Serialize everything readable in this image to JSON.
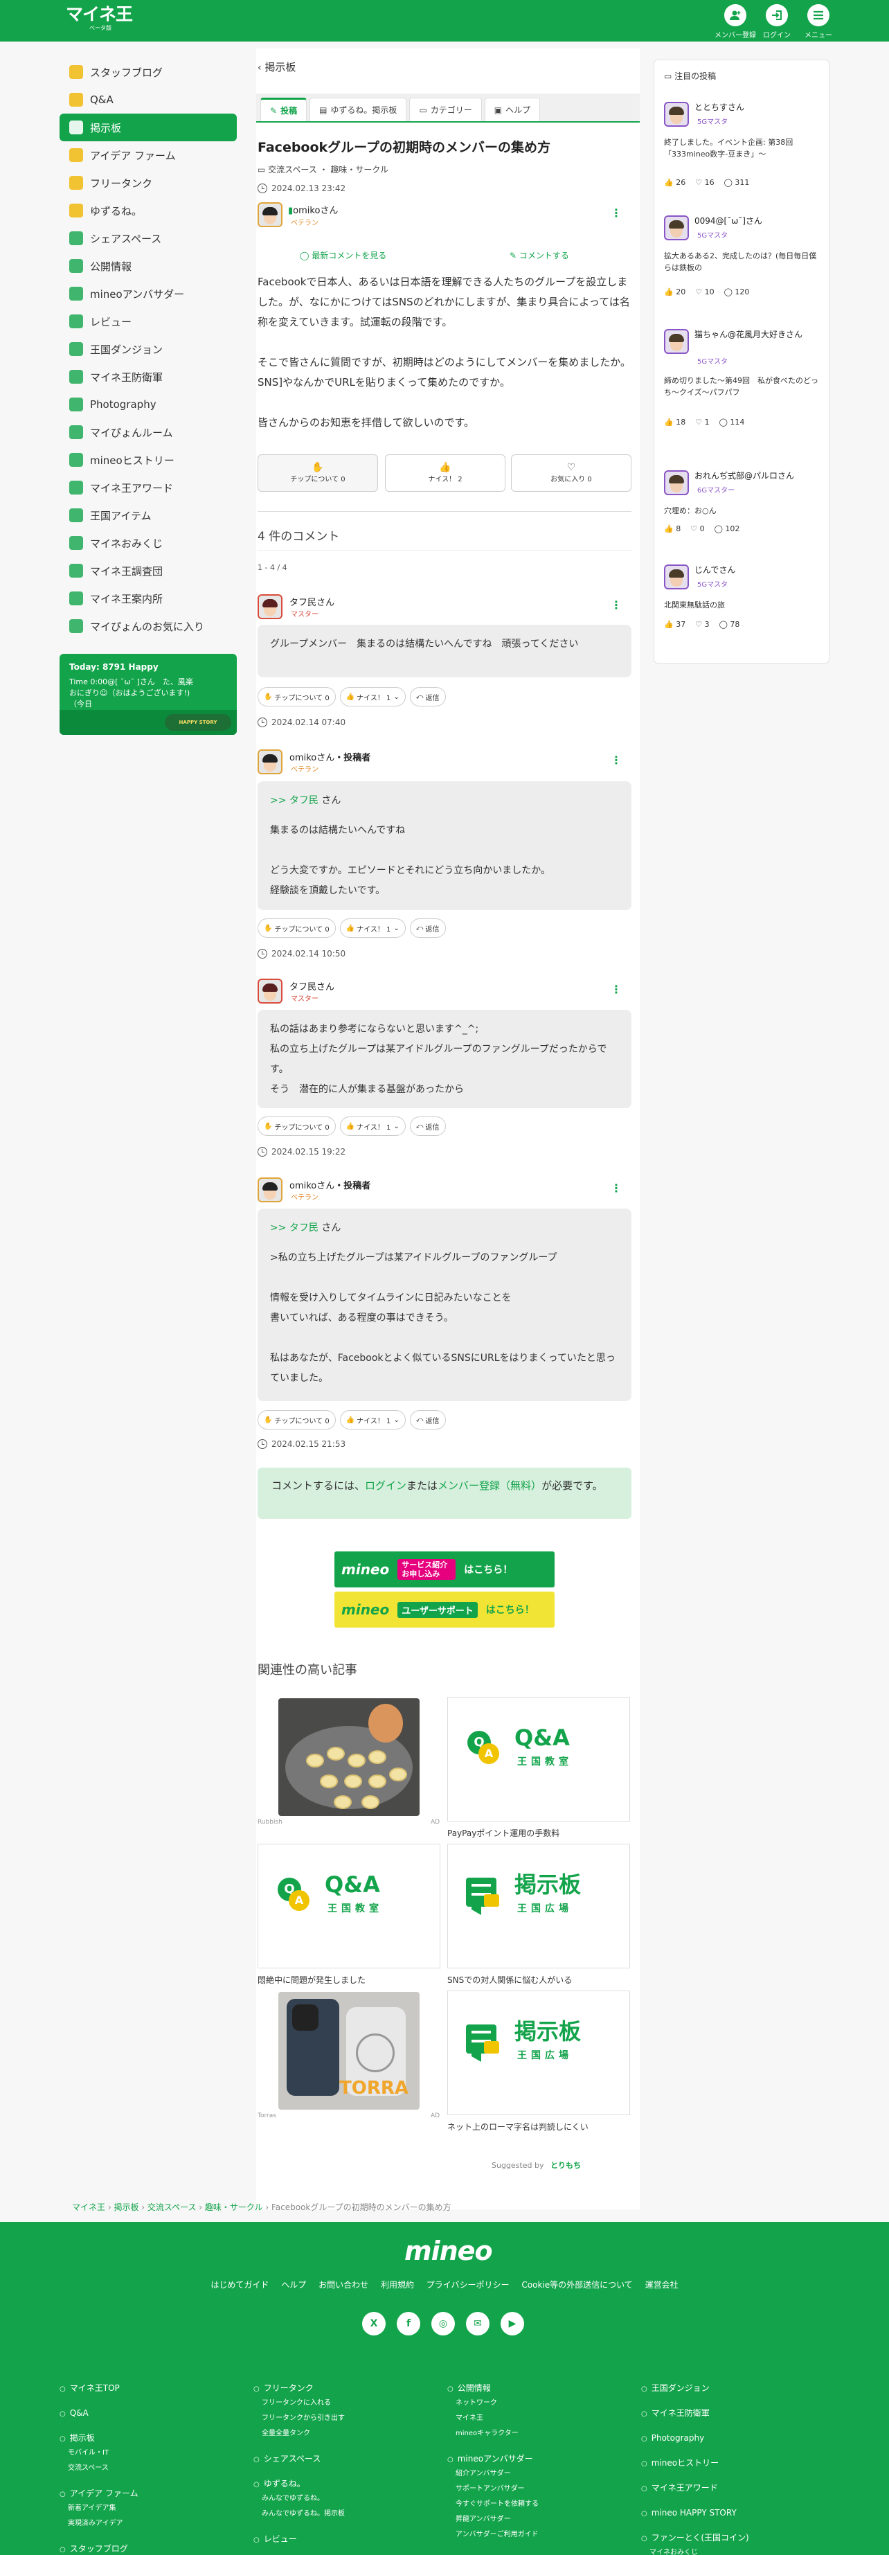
{
  "header": {
    "logo_main": "マイネ王",
    "logo_sub": "ベータ版",
    "register": "メンバー登録",
    "login": "ログイン",
    "menu": "メニュー"
  },
  "nav": [
    {
      "label": "スタッフブログ",
      "color": "#f0b400"
    },
    {
      "label": "Q&A",
      "color": "#f0b400"
    },
    {
      "label": "掲示板",
      "color": "#f0b400",
      "active": true
    },
    {
      "label": "アイデア ファーム",
      "color": "#f0b400"
    },
    {
      "label": "フリータンク",
      "color": "#f0b400"
    },
    {
      "label": "ゆずるね。",
      "color": "#f0b400"
    },
    {
      "label": "シェアスペース",
      "color": "#13a44b"
    },
    {
      "label": "公開情報",
      "color": "#13a44b"
    },
    {
      "label": "mineoアンバサダー",
      "color": "#13a44b"
    },
    {
      "label": "レビュー",
      "color": "#13a44b"
    },
    {
      "label": "王国ダンジョン",
      "color": "#13a44b"
    },
    {
      "label": "マイネ王防衛軍",
      "color": "#13a44b"
    },
    {
      "label": "Photography",
      "color": "#13a44b"
    },
    {
      "label": "マイぴょんルーム",
      "color": "#13a44b"
    },
    {
      "label": "mineoヒストリー",
      "color": "#13a44b"
    },
    {
      "label": "マイネ王アワード",
      "color": "#13a44b"
    },
    {
      "label": "王国アイテム",
      "color": "#13a44b"
    },
    {
      "label": "マイネおみくじ",
      "color": "#13a44b"
    },
    {
      "label": "マイネ王調査団",
      "color": "#13a44b"
    },
    {
      "label": "マイネ王案内所",
      "color": "#13a44b"
    },
    {
      "label": "マイぴょんのお気に入り",
      "color": "#13a44b"
    }
  ],
  "today": {
    "title": "Today: 8791 Happy",
    "line1": "Time 0:00@[ ˘ω˘ ]さん　た、風楽",
    "line2": "おにぎり☺（おはようございます!)",
    "line3": "（今日",
    "badge": "HAPPY STORY"
  },
  "main": {
    "back": "掲示板",
    "tabs": [
      "投稿",
      "ゆずるね。掲示板",
      "カテゴリー",
      "ヘルプ"
    ],
    "title": "Facebookグループの初期時のメンバーの集め方",
    "category": "交流スペース ・ 趣味・サークル",
    "post_date": "2024.02.13 23:42",
    "author": "omikoさん",
    "author_rank": "ベテラン",
    "latest_comments": "最新コメントを見る",
    "comment_action": "コメントする",
    "body": [
      "Facebookで日本人、あるいは日本語を理解できる人たちのグループを設立しました。が、なにかにつけてはSNSのどれかにしますが、集まり具合によっては名称を変えていきます。試運転の段階です。",
      "そこで皆さんに質問ですが、初期時はどのようにしてメンバーを集めましたか。SNS]やなんかでURLを貼りまくって集めたのですか。",
      "皆さんからのお知恵を拝借して欲しいのです。"
    ],
    "reactions": [
      {
        "label": "チップについて 0",
        "icon": "✋"
      },
      {
        "label": "ナイス！ 2",
        "icon": "👍"
      },
      {
        "label": "お気に入り 0",
        "icon": "♡"
      }
    ],
    "comments_heading": "4 件のコメント",
    "pager": "1 - 4 / 4",
    "comments": [
      {
        "author": "タフ民さん",
        "rank": "マスター",
        "op": "",
        "lines": [
          "グループメンバー　集まるのは結構たいへんですね　頑張ってください"
        ],
        "tip": "チップについて 0",
        "nice": "ナイス！ 1",
        "reply": "返信",
        "date": "2024.02.14 07:40"
      },
      {
        "author": "omikoさん",
        "rank": "ベテラン",
        "op": "・投稿者",
        "quote": ">> タフ民",
        "quote_suffix": " さん",
        "lines": [
          "集まるのは結構たいへんですね",
          "",
          "どう大変ですか。エピソードとそれにどう立ち向かいましたか。",
          "経験談を頂戴したいです。"
        ],
        "tip": "チップについて 0",
        "nice": "ナイス！ 1",
        "reply": "返信",
        "date": "2024.02.14 10:50"
      },
      {
        "author": "タフ民さん",
        "rank": "マスター",
        "op": "",
        "lines": [
          "私の話はあまり参考にならないと思います^_^;",
          "私の立ち上げたグループは某アイドルグループのファングループだったからです。",
          "そう　潜在的に人が集まる基盤があったから"
        ],
        "tip": "チップについて 0",
        "nice": "ナイス！ 1",
        "reply": "返信",
        "date": "2024.02.15 19:22"
      },
      {
        "author": "omikoさん",
        "rank": "ベテラン",
        "op": "・投稿者",
        "quote": ">> タフ民",
        "quote_suffix": " さん",
        "lines": [
          ">私の立ち上げたグループは某アイドルグループのファングループ",
          "",
          "情報を受け入りしてタイムラインに日記みたいなことを",
          "書いていれば、ある程度の事はできそう。",
          "",
          "私はあなたが、Facebookとよく似ているSNSにURLをはりまくっていたと思っていました。"
        ],
        "tip": "チップについて 0",
        "nice": "ナイス！ 1",
        "reply": "返信",
        "date": "2024.02.15 21:53"
      }
    ],
    "login_notice": {
      "pre": "コメントするには、",
      "login": "ログイン",
      "mid": "または",
      "register": "メンバー登録（無料）",
      "post": "が必要です。"
    },
    "banner1": {
      "brand": "mineo",
      "text": "サービス紹介 お申し込み",
      "cta": "はこちら！"
    },
    "banner2": {
      "brand": "mineo",
      "text": "ユーザーサポート",
      "cta": "はこちら！"
    },
    "related_heading": "関連性の高い記事",
    "related": [
      {
        "caption": "",
        "small_left": "Rubbish",
        "small_right": "AD",
        "kind": "food"
      },
      {
        "caption": "PayPayポイント運用の手数料",
        "kind": "qa"
      },
      {
        "caption": "悶絶中に問題が発生しました",
        "kind": "qa"
      },
      {
        "caption": "SNSでの対人関係に悩む人がいる",
        "kind": "board"
      },
      {
        "caption": "",
        "small_left": "Torras",
        "small_right": "AD",
        "kind": "phone",
        "brand": "TORRA"
      },
      {
        "caption": "ネット上のローマ字名は判読しにくい",
        "kind": "board"
      }
    ],
    "qa_text": {
      "big": "Q&A",
      "sub": "王国教室"
    },
    "board_text": {
      "big": "掲示板",
      "sub": "王国広場"
    },
    "suggested": "Suggested by",
    "suggested_brand": "とりもち"
  },
  "sidebar": {
    "title": "注目の投稿",
    "items": [
      {
        "name": "ととちすさん",
        "rank": "5Gマスタ",
        "text": "終了しました。イベント企画: 第38回「333mineo数字-豆まき」〜",
        "likes": "26",
        "hearts": "16",
        "comments": "311"
      },
      {
        "name": "0094@[˘ω˘]さん",
        "rank": "5Gマスタ",
        "text": "拡大あるある2、完成したのは？(毎日毎日僕らは鉄板の",
        "likes": "20",
        "hearts": "10",
        "comments": "120"
      },
      {
        "name": "猫ちゃん@花風月大好きさん",
        "rank": "5Gマスタ",
        "text": "締め切りました〜第49回　私が食べたのどっち〜クイズ〜パフパフ",
        "likes": "18",
        "hearts": "1",
        "comments": "114"
      },
      {
        "name": "おれんぢ式部@パルロさん",
        "rank": "6Gマスター",
        "text": "穴埋め：お○ん",
        "likes": "8",
        "hearts": "0",
        "comments": "102"
      },
      {
        "name": "じんでさん",
        "rank": "5Gマスタ",
        "text": "北関東無駄話の旅",
        "likes": "37",
        "hearts": "3",
        "comments": "78"
      }
    ]
  },
  "breadcrumb": [
    "マイネ王",
    "掲示板",
    "交流スペース",
    "趣味・サークル",
    "Facebookグループの初期時のメンバーの集め方"
  ],
  "footer": {
    "brand": "mineo",
    "links": [
      "はじめてガイド",
      "ヘルプ",
      "お問い合わせ",
      "利用規約",
      "プライバシーポリシー",
      "Cookie等の外部送信について",
      "運営会社"
    ],
    "social": [
      "X",
      "f",
      "◎",
      "✉",
      "▶"
    ],
    "col1": [
      {
        "t": "マイネ王TOP"
      },
      {
        "t": "Q&A"
      },
      {
        "t": "掲示板",
        "s": [
          "モバイル・IT",
          "交流スペース"
        ]
      },
      {
        "t": "アイデア ファーム",
        "s": [
          "新着アイデア集",
          "実現済みアイデア"
        ]
      },
      {
        "t": "スタッフブログ"
      }
    ],
    "col2": [
      {
        "t": "フリータンク",
        "s": [
          "フリータンクに入れる",
          "フリータンクから引き出す",
          "全量全量タンク"
        ]
      },
      {
        "t": "シェアスペース"
      },
      {
        "t": "ゆずるね。",
        "s": [
          "みんなでゆずるね。",
          "みんなでゆずるね。掲示板"
        ]
      },
      {
        "t": "レビュー"
      }
    ],
    "col3": [
      {
        "t": "公開情報",
        "s": [
          "ネットワーク",
          "マイネ王",
          "mineoキャラクター"
        ]
      },
      {
        "t": "mineoアンバサダー",
        "s": [
          "紹介アンバサダー",
          "サポートアンバサダー",
          "今すぐサポートを依頼する",
          "昇龍アンバサダー",
          "アンバサダーご利用ガイド"
        ]
      }
    ],
    "col4": [
      {
        "t": "王国ダンジョン"
      },
      {
        "t": "マイネ王防衛軍"
      },
      {
        "t": "Photography"
      },
      {
        "t": "mineoヒストリー"
      },
      {
        "t": "マイネ王アワード"
      },
      {
        "t": "mineo HAPPY STORY"
      },
      {
        "t": "ファンーとく(王国コイン)",
        "s": [
          "マイネおみくじ"
        ]
      }
    ]
  }
}
